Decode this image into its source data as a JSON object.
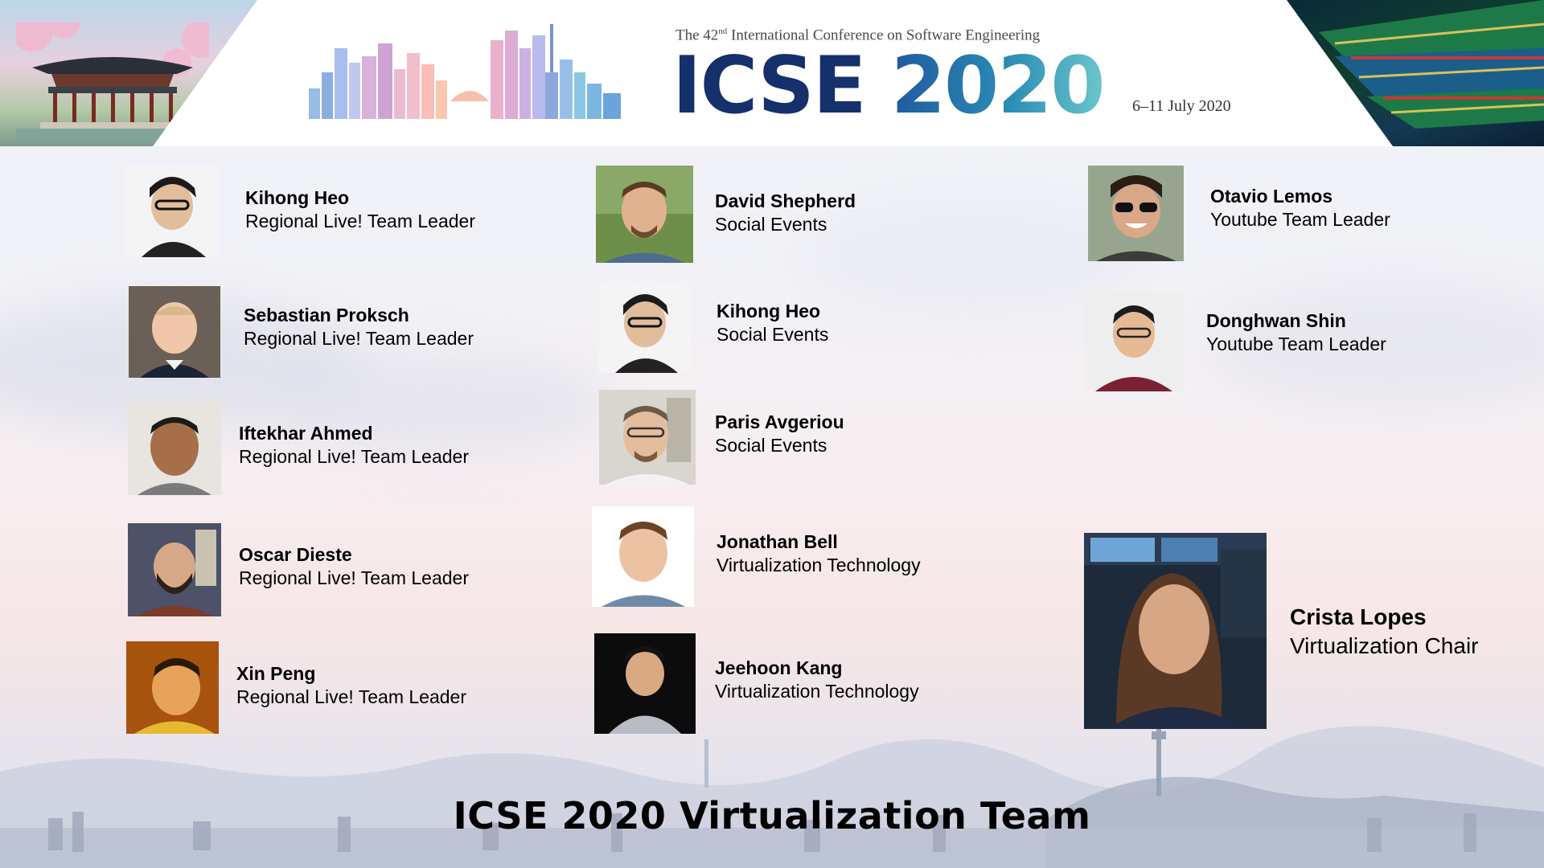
{
  "header": {
    "conference_prefix": "The 42",
    "conference_ordinal_suffix": "nd",
    "conference_rest": " International Conference on Software Engineering",
    "logo_icse": "ICSE ",
    "logo_year": "2020",
    "dates": "6–11 July 2020"
  },
  "members": [
    {
      "name": "Kihong Heo",
      "role": "Regional Live! Team Leader"
    },
    {
      "name": "Sebastian Proksch",
      "role": "Regional Live! Team Leader"
    },
    {
      "name": "Iftekhar Ahmed",
      "role": "Regional Live! Team Leader"
    },
    {
      "name": "Oscar Dieste",
      "role": "Regional Live! Team Leader"
    },
    {
      "name": "Xin Peng",
      "role": "Regional Live! Team Leader"
    },
    {
      "name": "David Shepherd",
      "role": "Social Events"
    },
    {
      "name": "Kihong Heo",
      "role": "Social Events"
    },
    {
      "name": "Paris Avgeriou",
      "role": "Social Events"
    },
    {
      "name": "Jonathan Bell",
      "role": "Virtualization Technology"
    },
    {
      "name": "Jeehoon Kang",
      "role": "Virtualization Technology"
    },
    {
      "name": "Otavio Lemos",
      "role": "Youtube Team Leader"
    },
    {
      "name": "Donghwan Shin",
      "role": "Youtube Team Leader"
    },
    {
      "name": "Crista Lopes",
      "role": "Virtualization Chair"
    }
  ],
  "footer": {
    "title": "ICSE 2020 Virtualization Team"
  }
}
